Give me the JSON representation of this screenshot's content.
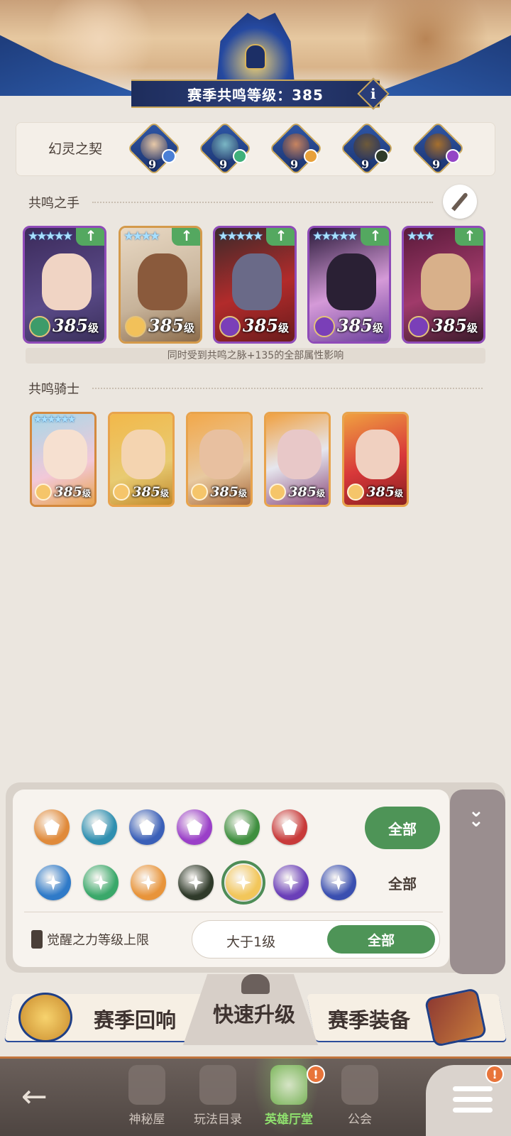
{
  "header": {
    "season_level_label": "赛季共鸣等级：385",
    "info_icon": "i"
  },
  "contract": {
    "label": "幻灵之契",
    "orbs": [
      {
        "level": "9",
        "face_color": "#e8c9a8",
        "badge_color": "#4a7fd6",
        "icon": "portrait-mustache-icon"
      },
      {
        "level": "9",
        "face_color": "#7ab6c4",
        "badge_color": "#3fb07a",
        "icon": "portrait-crab-icon"
      },
      {
        "level": "9",
        "face_color": "#c88460",
        "badge_color": "#e8a13b",
        "icon": "portrait-beast-icon"
      },
      {
        "level": "9",
        "face_color": "#6e5a3a",
        "badge_color": "#2f3b2a",
        "icon": "portrait-dragon-icon"
      },
      {
        "level": "9",
        "face_color": "#a6702e",
        "badge_color": "#9446c6",
        "icon": "portrait-bird-icon"
      }
    ]
  },
  "hands": {
    "title": "共鸣之手",
    "note": "同时受到共鸣之脉+135的全部属性影响",
    "heroes": [
      {
        "stars": "★★★★★",
        "level": "385",
        "unit": "级",
        "border": "purple",
        "bg": "linear-gradient(160deg,#3b2a5a,#5a4a88 60%,#3a2f5a)",
        "face": "#f0d4c4",
        "faction": "#3d9b6a"
      },
      {
        "stars": "★★★★",
        "level": "385",
        "unit": "级",
        "border": "gold",
        "bg": "linear-gradient(160deg,#e9d9c4,#c7b39a 60%,#8b6b4a)",
        "face": "#8a5a3c",
        "faction": "#f2c15a"
      },
      {
        "stars": "★★★★★",
        "level": "385",
        "unit": "级",
        "border": "purple",
        "bg": "linear-gradient(160deg,#3a2a2a,#b22b2b 55%,#6a1c1c)",
        "face": "#6a6a88",
        "faction": "#7a3fb8"
      },
      {
        "stars": "★★★★★",
        "level": "385",
        "unit": "级",
        "border": "purple",
        "bg": "linear-gradient(160deg,#2a1a3a,#d59ad8 55%,#6a3f9a)",
        "face": "#2a2034",
        "faction": "#7a3fb8"
      },
      {
        "stars": "★★★",
        "level": "385",
        "unit": "级",
        "border": "purple",
        "bg": "linear-gradient(160deg,#5a1a3a,#a03a6a 55%,#3a1a2a)",
        "face": "#d8b08a",
        "faction": "#7a3fb8"
      }
    ]
  },
  "knights": {
    "title": "共鸣骑士",
    "items": [
      {
        "stars": "★★★★★★",
        "level": "385",
        "unit": "级",
        "bg": "linear-gradient(160deg,#a7d8e8,#f2c8d8 60%,#e8a34c)",
        "face": "#f6e0d0"
      },
      {
        "stars": "",
        "level": "385",
        "unit": "级",
        "bg": "linear-gradient(160deg,#f2b84a,#e8cb72 60%,#c28a2c)",
        "face": "#f4d4b0"
      },
      {
        "stars": "",
        "level": "385",
        "unit": "级",
        "bg": "linear-gradient(160deg,#f2a84a,#e8c9a0 60%,#a86a3c)",
        "face": "#e8c0a0"
      },
      {
        "stars": "",
        "level": "385",
        "unit": "级",
        "bg": "linear-gradient(160deg,#f0a040,#e6e6ee 50%,#8a4a7a)",
        "face": "#e8c8c8"
      },
      {
        "stars": "",
        "level": "385",
        "unit": "级",
        "bg": "linear-gradient(160deg,#f0a040,#d8383a 55%,#8a2020)",
        "face": "#f0d0c0"
      }
    ]
  },
  "filters": {
    "class_all_label": "全部",
    "faction_all_label": "全部",
    "class_icons": [
      {
        "name": "shield-class-icon",
        "color": "#e08a3a"
      },
      {
        "name": "wing-class-icon",
        "color": "#2f8fb0"
      },
      {
        "name": "bow-class-icon",
        "color": "#3a5fb8"
      },
      {
        "name": "magic-class-icon",
        "color": "#9a3fc8"
      },
      {
        "name": "dagger-class-icon",
        "color": "#3f8f3f"
      },
      {
        "name": "sword-class-icon",
        "color": "#c83a3a"
      }
    ],
    "faction_icons": [
      {
        "name": "star-faction-icon",
        "color": "#2f7ac8",
        "selected": false
      },
      {
        "name": "leaf-faction-icon",
        "color": "#3aa86a",
        "selected": false
      },
      {
        "name": "sun-faction-icon",
        "color": "#e8943a",
        "selected": false
      },
      {
        "name": "eye-faction-icon",
        "color": "#2f3a2a",
        "selected": false
      },
      {
        "name": "light-faction-icon",
        "color": "#f2c65a",
        "selected": true
      },
      {
        "name": "dark-faction-icon",
        "color": "#6a3fb8",
        "selected": false
      },
      {
        "name": "cosmic-faction-icon",
        "color": "#3a4fb0",
        "selected": false
      }
    ],
    "awake_label": "觉醒之力等级上限",
    "awake_value": "大于1级",
    "awake_all_label": "全部"
  },
  "actions": {
    "left_label": "赛季回响",
    "center_label": "快速升级",
    "right_label": "赛季装备"
  },
  "nav": {
    "items": [
      {
        "label": "神秘屋",
        "active": false
      },
      {
        "label": "玩法目录",
        "active": false
      },
      {
        "label": "英雄厅堂",
        "active": true
      },
      {
        "label": "公会",
        "active": false
      }
    ],
    "badge": "!"
  }
}
